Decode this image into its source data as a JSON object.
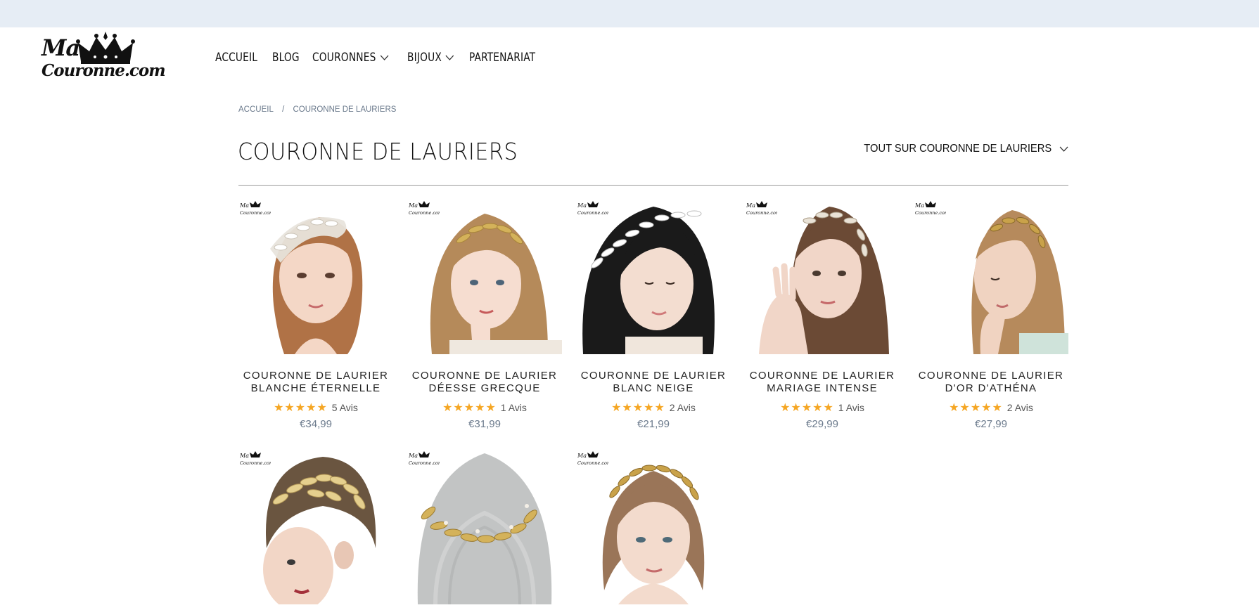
{
  "logo": {
    "line1": "Ma",
    "line2": "Couronne.com"
  },
  "nav": {
    "items": [
      {
        "label": "ACCUEIL"
      },
      {
        "label": "BLOG"
      },
      {
        "label": "COURONNES"
      },
      {
        "label": "BIJOUX"
      },
      {
        "label": "PARTENARIAT"
      }
    ]
  },
  "breadcrumb": {
    "home": "ACCUEIL",
    "separator": "/",
    "current": "COURONNE DE LAURIERS"
  },
  "page": {
    "title": "COURONNE DE LAURIERS"
  },
  "filter": {
    "label": "TOUT SUR COURONNE DE LAURIERS"
  },
  "watermark": {
    "line1": "Ma",
    "line2": "Couronne.com"
  },
  "products": [
    {
      "title1": "COURONNE DE LAURIER",
      "title2": "BLANCHE ÉTERNELLE",
      "stars": "★★★★★",
      "reviews": "5 Avis",
      "price": "€34,99"
    },
    {
      "title1": "COURONNE DE LAURIER",
      "title2": "DÉESSE GRECQUE",
      "stars": "★★★★★",
      "reviews": "1 Avis",
      "price": "€31,99"
    },
    {
      "title1": "COURONNE DE LAURIER",
      "title2": "BLANC NEIGE",
      "stars": "★★★★★",
      "reviews": "2 Avis",
      "price": "€21,99"
    },
    {
      "title1": "COURONNE DE LAURIER",
      "title2": "MARIAGE INTENSE",
      "stars": "★★★★★",
      "reviews": "1 Avis",
      "price": "€29,99"
    },
    {
      "title1": "COURONNE DE LAURIER",
      "title2": "D'OR D'ATHÉNA",
      "stars": "★★★★★",
      "reviews": "2 Avis",
      "price": "€27,99"
    }
  ],
  "icons": {
    "dropdown": "chevron-down-icon",
    "crown": "crown-icon",
    "star": "star-icon"
  },
  "colors": {
    "topbar": "#e6edf5",
    "star": "#f5a623",
    "price": "#6b7a8c",
    "gold": "#c9a24a"
  }
}
